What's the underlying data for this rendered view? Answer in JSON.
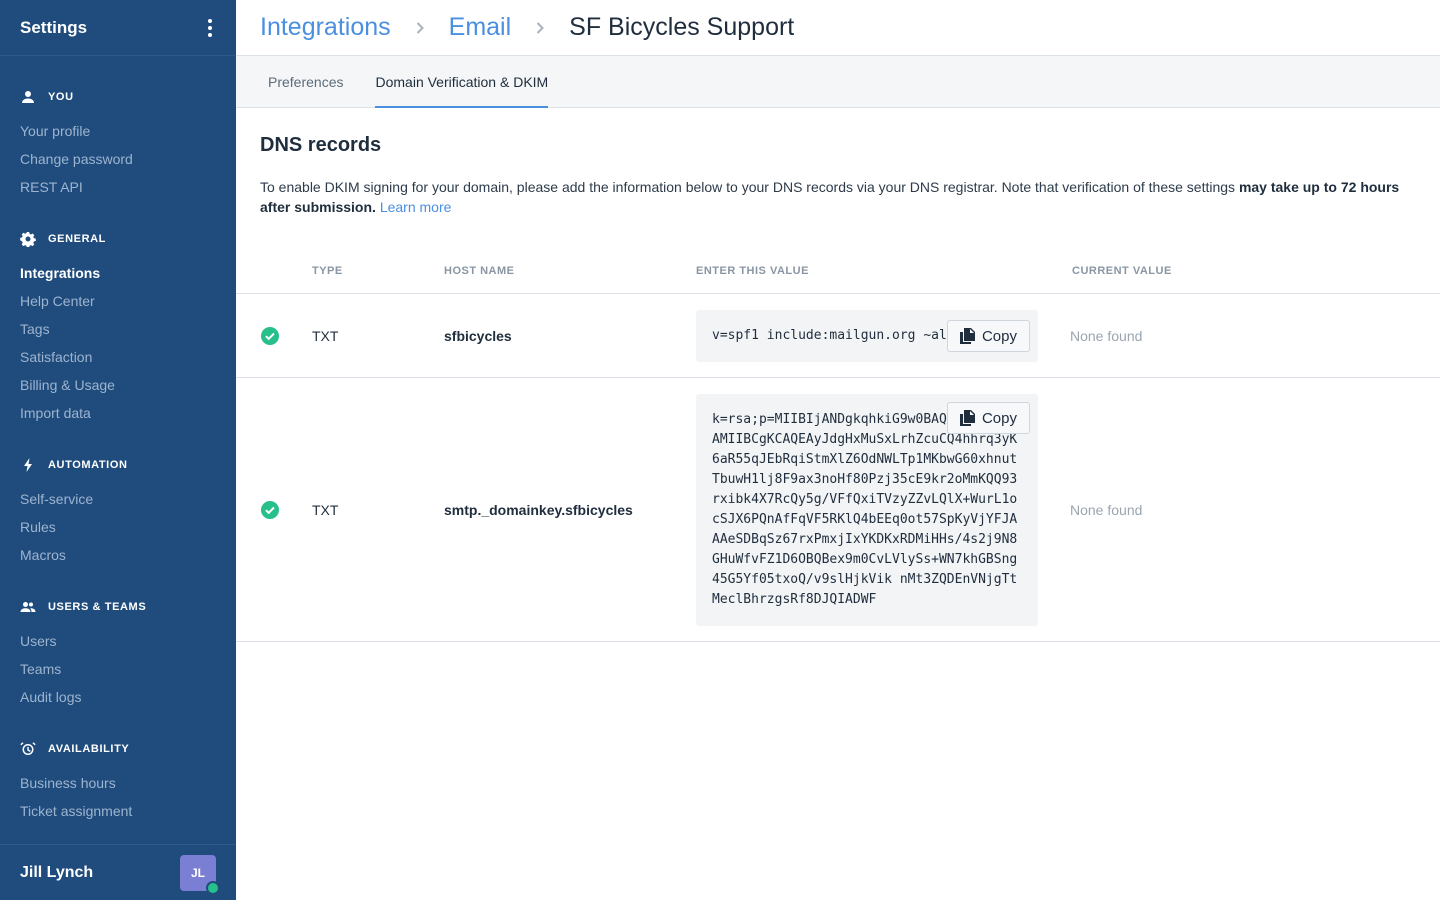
{
  "sidebar": {
    "title": "Settings",
    "sections": [
      {
        "label": "YOU",
        "icon": "person-icon",
        "items": [
          {
            "label": "Your profile",
            "active": false
          },
          {
            "label": "Change password",
            "active": false
          },
          {
            "label": "REST API",
            "active": false
          }
        ]
      },
      {
        "label": "GENERAL",
        "icon": "gear-icon",
        "items": [
          {
            "label": "Integrations",
            "active": true
          },
          {
            "label": "Help Center",
            "active": false
          },
          {
            "label": "Tags",
            "active": false
          },
          {
            "label": "Satisfaction",
            "active": false
          },
          {
            "label": "Billing & Usage",
            "active": false
          },
          {
            "label": "Import data",
            "active": false
          }
        ]
      },
      {
        "label": "AUTOMATION",
        "icon": "bolt-icon",
        "items": [
          {
            "label": "Self-service",
            "active": false
          },
          {
            "label": "Rules",
            "active": false
          },
          {
            "label": "Macros",
            "active": false
          }
        ]
      },
      {
        "label": "USERS & TEAMS",
        "icon": "people-icon",
        "items": [
          {
            "label": "Users",
            "active": false
          },
          {
            "label": "Teams",
            "active": false
          },
          {
            "label": "Audit logs",
            "active": false
          }
        ]
      },
      {
        "label": "AVAILABILITY",
        "icon": "alarm-clock-icon",
        "items": [
          {
            "label": "Business hours",
            "active": false
          },
          {
            "label": "Ticket assignment",
            "active": false
          }
        ]
      }
    ],
    "user": {
      "name": "Jill Lynch",
      "initials": "JL",
      "status_color": "#27c08a"
    }
  },
  "breadcrumb": [
    "Integrations",
    "Email",
    "SF Bicycles Support"
  ],
  "tabs": [
    {
      "label": "Preferences",
      "active": false
    },
    {
      "label": "Domain Verification & DKIM",
      "active": true
    }
  ],
  "content": {
    "heading": "DNS records",
    "description_start": "To enable DKIM signing for your domain, please add the information below to your DNS records via your DNS registrar. Note that verification of these settings ",
    "description_bold": "may take up to 72 hours after submission.",
    "learn_more": "Learn more"
  },
  "table": {
    "headers": {
      "type": "TYPE",
      "host": "HOST NAME",
      "value": "ENTER THIS VALUE",
      "current": "CURRENT VALUE"
    },
    "copy_label": "Copy",
    "rows": [
      {
        "verified": true,
        "type": "TXT",
        "host": "sfbicycles",
        "value": "v=spf1 include:mailgun.org ~all",
        "current": "None found"
      },
      {
        "verified": true,
        "type": "TXT",
        "host": "smtp._domainkey.sfbicycles",
        "value": "k=rsa;p=MIIBIjANDgkqhkiG9w0BAQEFAAOCAQ8AMIIBCgKCAQEAyJdgHxMuSxLrhZcuCQ4hhrq3yK6aR55qJEbRqiStmXlZ6OdNWLTp1MKbwG60xhnutTbuwH1lj8F9ax3noHf80Pzj35cE9kr2oMmKQQ93rxibk4X7RcQy5g/VFfQxiTVzyZZvLQlX+WurL1ocSJX6PQnAfFqVF5RKlQ4bEEq0ot57SpKyVjYFJAAAeSDBqSz67rxPmxjIxYKDKxRDMiHHs/4s2j9N8GHuWfvFZ1D6OBQBex9m0CvLVlySs+WN7khGBSng45G5Yf05txoQ/v9slHjkVik nMt3ZQDEnVNjgTtMeclBhrzgsRf8DJQIADWF",
        "current": "None found"
      }
    ]
  },
  "colors": {
    "sidebar_bg": "#1f4c7d",
    "accent": "#4a8fe0",
    "success": "#27c08a"
  }
}
